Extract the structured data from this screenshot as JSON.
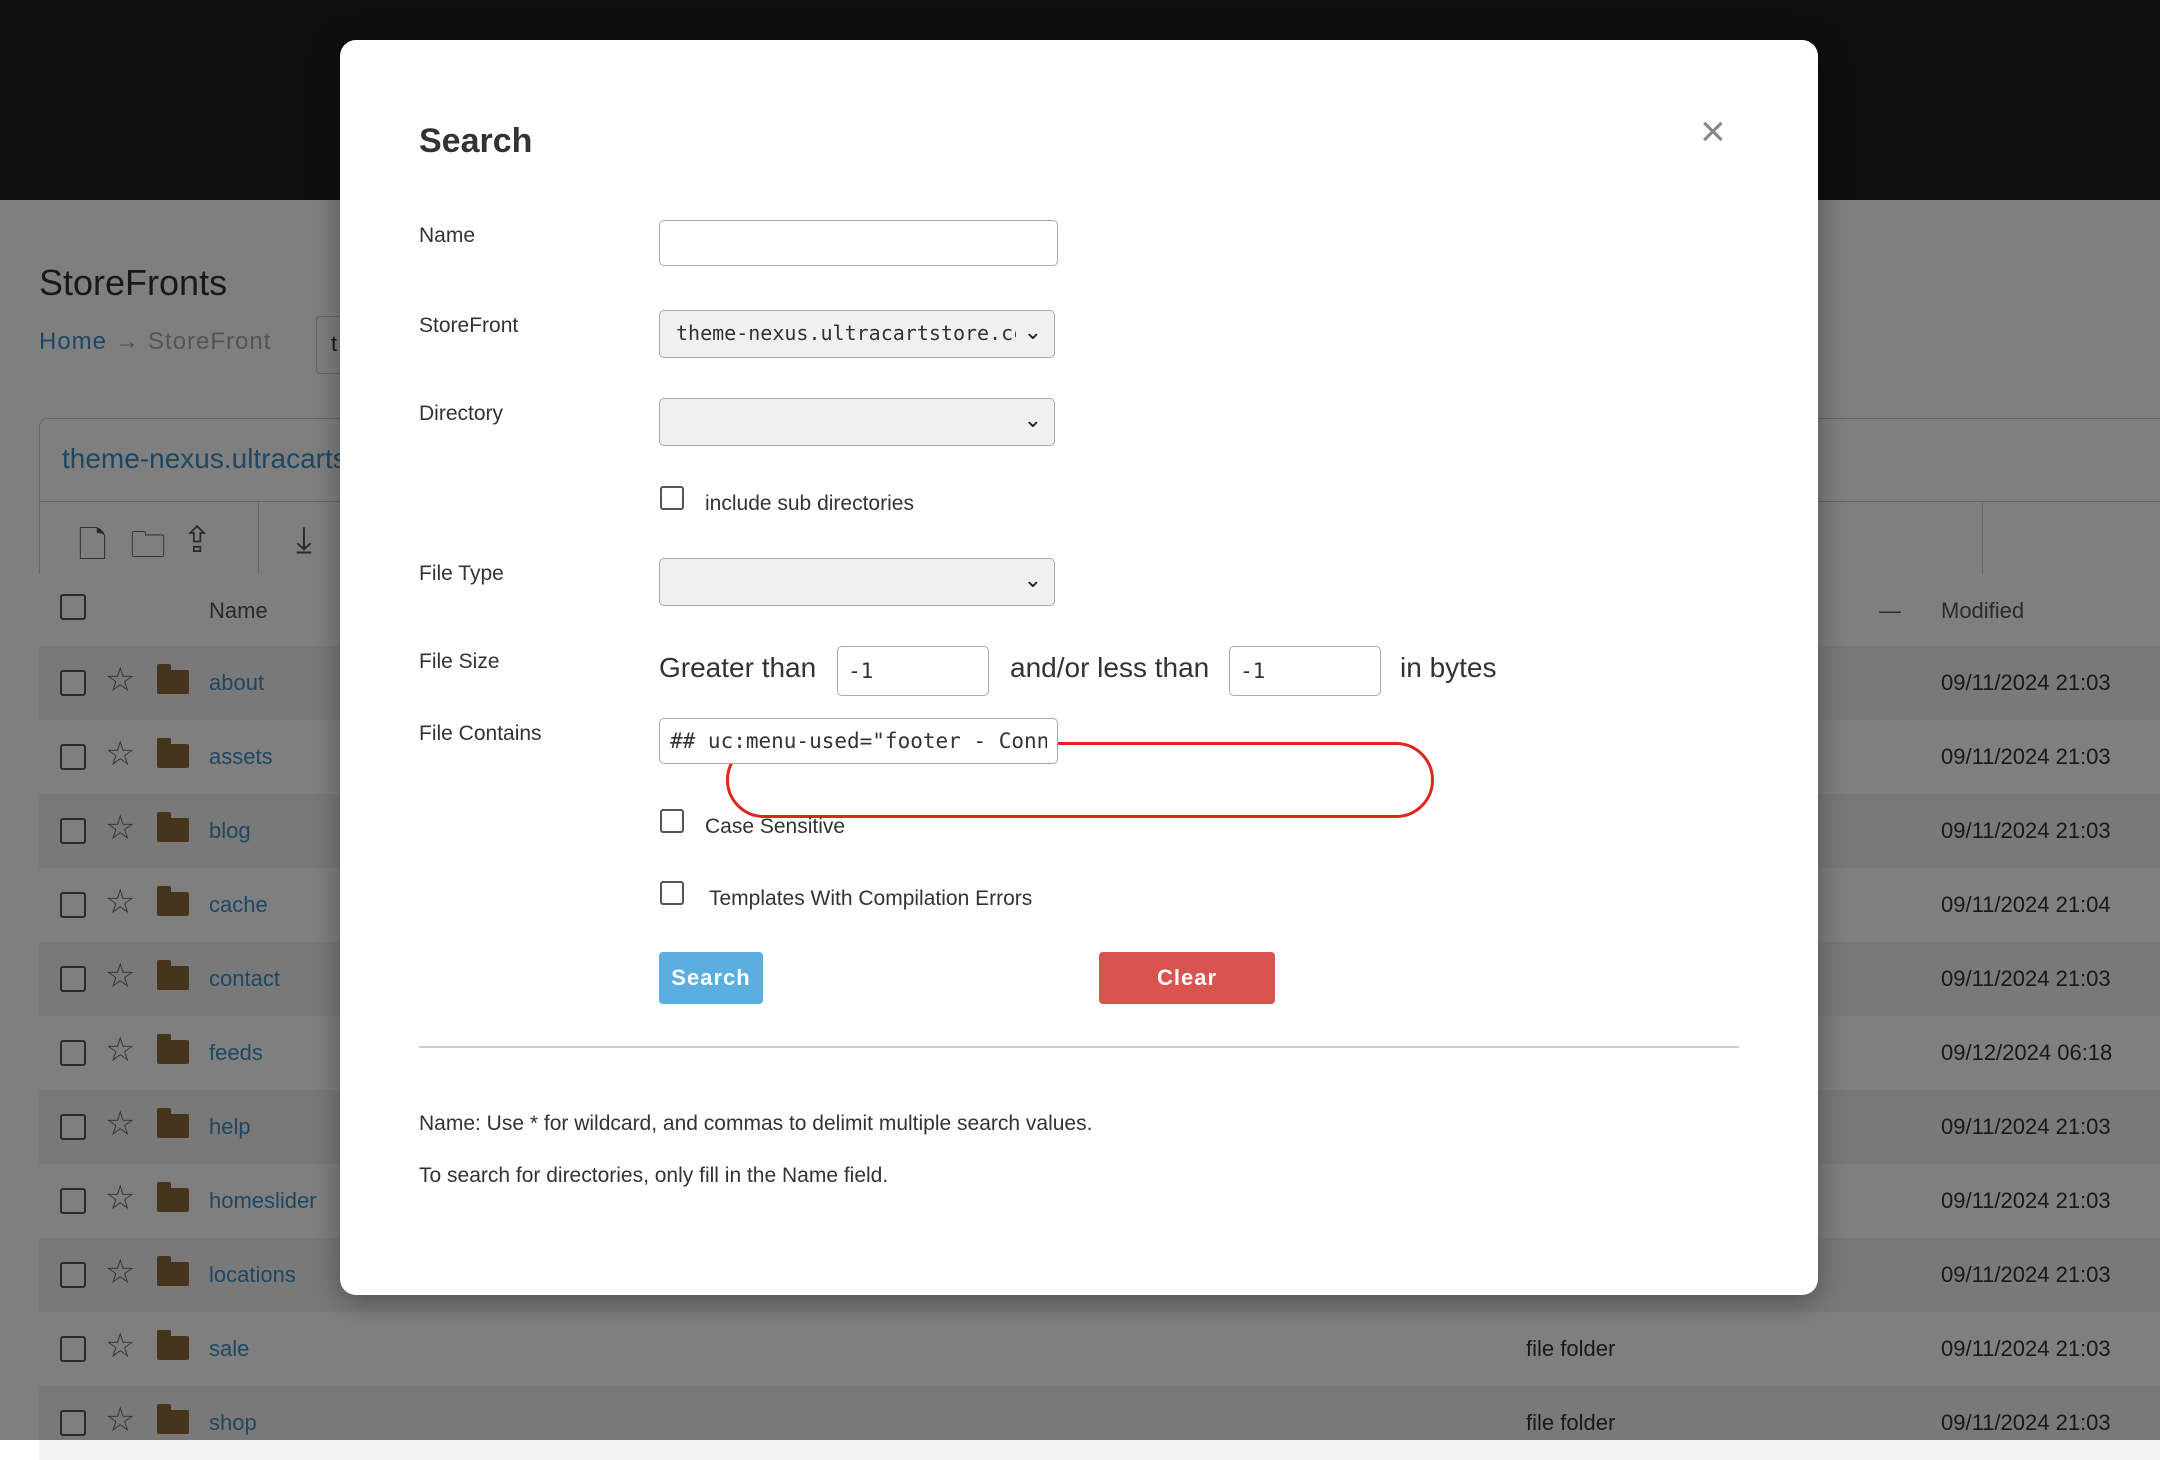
{
  "page": {
    "title": "StoreFronts",
    "breadcrumb": [
      "Home",
      "StoreFront"
    ],
    "breadcrumb_select_value": "t",
    "panel_title": "theme-nexus.ultracarts"
  },
  "table": {
    "col_name": "Name",
    "col_modified": "Modified",
    "col_collapse": "—",
    "rows": [
      {
        "name": "about",
        "type": "",
        "modified": "09/11/2024 21:03"
      },
      {
        "name": "assets",
        "type": "",
        "modified": "09/11/2024 21:03"
      },
      {
        "name": "blog",
        "type": "",
        "modified": "09/11/2024 21:03"
      },
      {
        "name": "cache",
        "type": "",
        "modified": "09/11/2024 21:04"
      },
      {
        "name": "contact",
        "type": "",
        "modified": "09/11/2024 21:03"
      },
      {
        "name": "feeds",
        "type": "",
        "modified": "09/12/2024 06:18"
      },
      {
        "name": "help",
        "type": "",
        "modified": "09/11/2024 21:03"
      },
      {
        "name": "homeslider",
        "type": "",
        "modified": "09/11/2024 21:03"
      },
      {
        "name": "locations",
        "type": "",
        "modified": "09/11/2024 21:03"
      },
      {
        "name": "sale",
        "type": "file folder",
        "modified": "09/11/2024 21:03"
      },
      {
        "name": "shop",
        "type": "file folder",
        "modified": "09/11/2024 21:03"
      }
    ]
  },
  "modal": {
    "title": "Search",
    "close_glyph": "×",
    "name_label": "Name",
    "name_value": "",
    "storefront_label": "StoreFront",
    "storefront_value": "theme-nexus.ultracartstore.cc",
    "directory_label": "Directory",
    "directory_value": "",
    "include_sub_label": "include sub directories",
    "file_type_label": "File Type",
    "file_type_value": "",
    "file_size_label": "File Size",
    "greater_than": "Greater than",
    "greater_value": "-1",
    "less_than": "and/or less than",
    "less_value": "-1",
    "in_bytes": "in bytes",
    "file_contains_label": "File Contains",
    "file_contains_value": "## uc:menu-used=\"footer - Conn",
    "case_sensitive_label": "Case Sensitive",
    "templates_errors_label": "Templates With Compilation Errors",
    "search_button": "Search",
    "clear_button": "Clear",
    "help_1": "Name: Use * for wildcard, and commas to delimit multiple search values.",
    "help_2": "To search for directories, only fill in the Name field."
  },
  "colors": {
    "highlight": "#e0251c",
    "search_button": "#5aaee0",
    "clear_button": "#d9534f",
    "link": "#3a8fc9"
  },
  "icons": [
    "close-icon",
    "chevron-down-icon",
    "star-icon",
    "folder-icon",
    "new-file-icon",
    "new-folder-icon",
    "upload-icon",
    "download-icon"
  ]
}
